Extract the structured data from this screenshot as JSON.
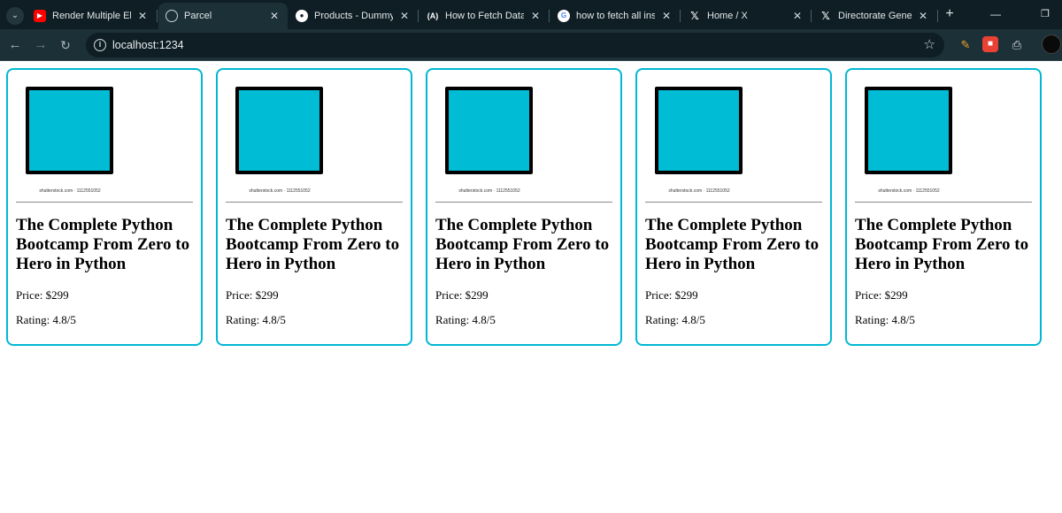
{
  "browser": {
    "tabs": [
      {
        "title": "Render Multiple Elem",
        "favicon": "youtube-icon",
        "active": false
      },
      {
        "title": "Parcel",
        "favicon": "globe-icon",
        "active": true
      },
      {
        "title": "Products - DummyJS",
        "favicon": "dummyjson-icon",
        "active": false
      },
      {
        "title": "How to Fetch Data fr",
        "favicon": "angle-icon",
        "active": false
      },
      {
        "title": "how to fetch all insid",
        "favicon": "google-icon",
        "active": false
      },
      {
        "title": "Home / X",
        "favicon": "x-icon",
        "active": false
      },
      {
        "title": "Directorate General c",
        "favicon": "x-icon",
        "active": false
      }
    ],
    "url": "localhost:1234",
    "colors": {
      "accent": "#00b8d4",
      "chrome_bg": "#0f1e24",
      "toolbar_bg": "#1c3038"
    }
  },
  "products": [
    {
      "watermark": "shutterstock.com · 1112551052",
      "title": "The Complete Python Bootcamp From Zero to Hero in Python",
      "price": "Price: $299",
      "rating": "Rating: 4.8/5"
    },
    {
      "watermark": "shutterstock.com · 1112551052",
      "title": "The Complete Python Bootcamp From Zero to Hero in Python",
      "price": "Price: $299",
      "rating": "Rating: 4.8/5"
    },
    {
      "watermark": "shutterstock.com · 1112551052",
      "title": "The Complete Python Bootcamp From Zero to Hero in Python",
      "price": "Price: $299",
      "rating": "Rating: 4.8/5"
    },
    {
      "watermark": "shutterstock.com · 1112551052",
      "title": "The Complete Python Bootcamp From Zero to Hero in Python",
      "price": "Price: $299",
      "rating": "Rating: 4.8/5"
    },
    {
      "watermark": "shutterstock.com · 1112551052",
      "title": "The Complete Python Bootcamp From Zero to Hero in Python",
      "price": "Price: $299",
      "rating": "Rating: 4.8/5"
    }
  ]
}
